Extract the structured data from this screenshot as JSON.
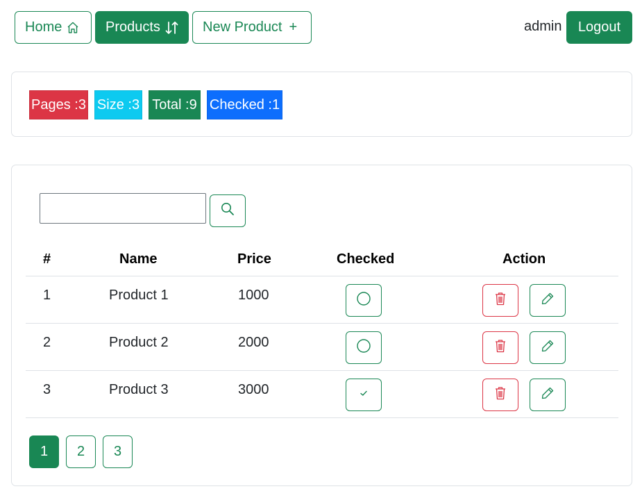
{
  "nav": {
    "home_label": "Home",
    "products_label": "Products",
    "new_product_label": "New Product",
    "new_product_plus": "+",
    "username": "admin",
    "logout_label": "Logout"
  },
  "stats": {
    "pages": "Pages :3",
    "size": "Size :3",
    "total": "Total :9",
    "checked": "Checked :1"
  },
  "search": {
    "value": "",
    "placeholder": ""
  },
  "table": {
    "headers": {
      "index": "#",
      "name": "Name",
      "price": "Price",
      "checked": "Checked",
      "action": "Action"
    },
    "rows": [
      {
        "index": "1",
        "name": "Product 1",
        "price": "1000",
        "checked": false
      },
      {
        "index": "2",
        "name": "Product 2",
        "price": "2000",
        "checked": false
      },
      {
        "index": "3",
        "name": "Product 3",
        "price": "3000",
        "checked": true
      }
    ]
  },
  "pagination": {
    "pages": [
      "1",
      "2",
      "3"
    ],
    "current": "1"
  },
  "colors": {
    "success": "#198754",
    "danger": "#dc3545",
    "info": "#0dcaf0",
    "primary": "#0d6efd",
    "border": "#dee2e6"
  },
  "icons": {
    "home": "house-icon",
    "products": "sort-arrows-icon",
    "search": "search-icon",
    "unchecked": "circle-icon",
    "checked": "check-icon",
    "delete": "trash-icon",
    "edit": "pencil-icon"
  }
}
